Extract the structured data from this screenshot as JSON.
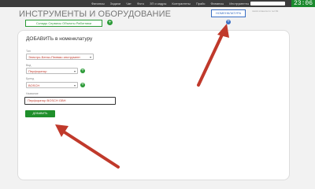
{
  "topnav": {
    "items": [
      "Финансы",
      "Задачи",
      "Чат",
      "Фото",
      "ЗП и кадры",
      "Контрагенты",
      "Прайс",
      "Финансы",
      "Инструменты"
    ],
    "badge1": "3",
    "badge2": "0",
    "search_placeholder": "поиск клиента по тел №",
    "clock": "23:06"
  },
  "header": {
    "title": "ИНСТРУМЕНТЫ И ОБОРУДОВАНИЕ",
    "nomenclature_button": "НОМЕНКЛАТУРА",
    "filter_label": "Склады Сервисы Объекты Работники"
  },
  "form": {
    "title": "ДОБАВИТЬ в номенклатуру",
    "type_label": "Тип",
    "type_value": "Электро-Бензо-Пневмо инструмент",
    "kind_label": "Вид",
    "kind_value": "Перфоратор",
    "brand_label": "Бренд",
    "brand_value": "BOSCH",
    "name_label": "Название",
    "name_value": "Перфоратор BOSCH GBH",
    "submit_label": "ДОБАВИТЬ"
  },
  "colors": {
    "accent_green": "#2a9a36",
    "accent_blue": "#3a6fc4",
    "arrow_red": "#c0392b"
  }
}
